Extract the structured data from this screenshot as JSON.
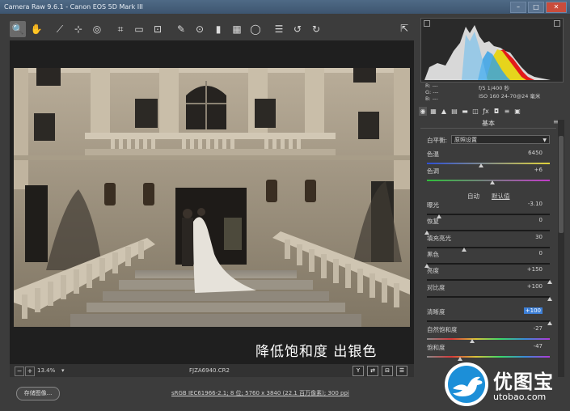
{
  "window": {
    "title": "Camera Raw 9.6.1 - Canon EOS 5D Mark III"
  },
  "toolbar": {
    "tools": [
      {
        "icon": "zoom-icon",
        "glyph": "🔍"
      },
      {
        "icon": "hand-icon",
        "glyph": "✋"
      },
      {
        "icon": "white-balance-icon",
        "glyph": "⟋"
      },
      {
        "icon": "color-sampler-icon",
        "glyph": "⊹"
      },
      {
        "icon": "target-adjust-icon",
        "glyph": "◎"
      },
      {
        "icon": "crop-icon",
        "glyph": "⌗"
      },
      {
        "icon": "straighten-icon",
        "glyph": "▭"
      },
      {
        "icon": "transform-icon",
        "glyph": "⊡"
      },
      {
        "icon": "spot-removal-icon",
        "glyph": "✎"
      },
      {
        "icon": "red-eye-icon",
        "glyph": "⊙"
      },
      {
        "icon": "adjustment-brush-icon",
        "glyph": "▮"
      },
      {
        "icon": "graduated-filter-icon",
        "glyph": "▦"
      },
      {
        "icon": "radial-filter-icon",
        "glyph": "◯"
      },
      {
        "icon": "preferences-icon",
        "glyph": "☰"
      },
      {
        "icon": "rotate-ccw-icon",
        "glyph": "↺"
      },
      {
        "icon": "rotate-cw-icon",
        "glyph": "↻"
      }
    ]
  },
  "canvas": {
    "caption": "降低饱和度 出银色"
  },
  "statusbar": {
    "zoom": "13.4%",
    "filename": "FJZA6940.CR2"
  },
  "histogram": {
    "readout_r": "R:  ---",
    "readout_g": "G:  ---",
    "readout_b": "B:  ---",
    "exposure": "f/5   1/400 秒",
    "lens": "ISO 160   24-70@24 毫米"
  },
  "panel": {
    "title": "基本",
    "white_balance_label": "白平衡:",
    "white_balance_value": "原照设置",
    "auto_link": "自动",
    "default_link": "默认值",
    "sliders": [
      {
        "key": "temperature",
        "label": "色温",
        "value": "6450",
        "level": 0.44
      },
      {
        "key": "tint",
        "label": "色调",
        "value": "+6",
        "level": 0.53
      },
      {
        "key": "exposure",
        "label": "曝光",
        "value": "-3.10",
        "level": 0.1
      },
      {
        "key": "recovery",
        "label": "恢复",
        "value": "0",
        "level": 0.0
      },
      {
        "key": "fill-light",
        "label": "填充亮光",
        "value": "30",
        "level": 0.3
      },
      {
        "key": "blacks",
        "label": "黑色",
        "value": "0",
        "level": 0.0
      },
      {
        "key": "brightness",
        "label": "亮度",
        "value": "+150",
        "level": 1.0
      },
      {
        "key": "contrast",
        "label": "对比度",
        "value": "+100",
        "level": 1.0
      },
      {
        "key": "clarity",
        "label": "清晰度",
        "value": "+100",
        "level": 1.0
      },
      {
        "key": "vibrance",
        "label": "自然饱和度",
        "value": "-27",
        "level": 0.37
      },
      {
        "key": "saturation",
        "label": "饱和度",
        "value": "-47",
        "level": 0.27
      }
    ]
  },
  "bottom": {
    "save_label": "存储图像...",
    "workflow_link": "sRGB IEC61966-2.1; 8 位; 5760 x 3840 (22.1 百万像素); 300 ppi"
  },
  "watermark": {
    "title": "优图宝",
    "url": "utobao.com"
  }
}
